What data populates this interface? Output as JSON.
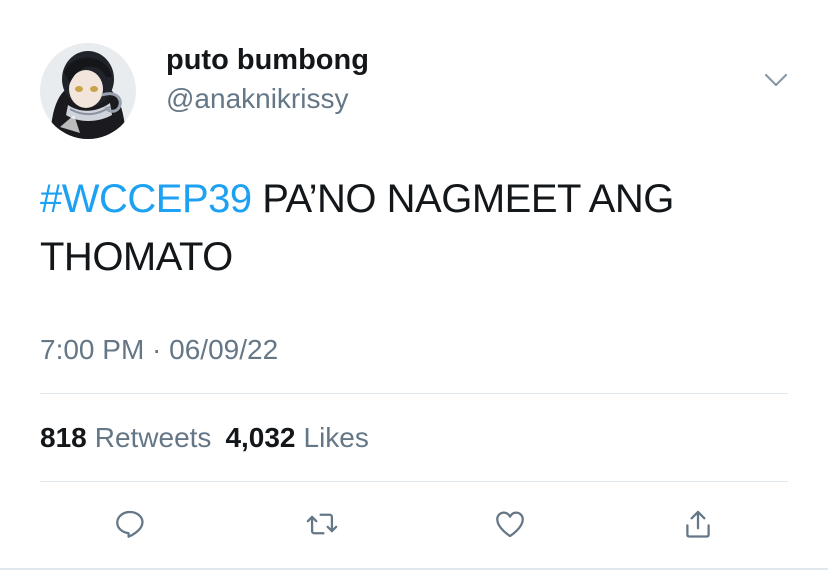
{
  "user": {
    "display_name": "puto bumbong",
    "handle": "@anaknikrissy"
  },
  "tweet": {
    "hashtag": "#WCCEP39",
    "text": " PA’NO NAGMEET ANG THOMATO",
    "timestamp": "7:00 PM · 06/09/22"
  },
  "stats": {
    "retweets_count": "818",
    "retweets_label": "Retweets",
    "likes_count": "4,032",
    "likes_label": "Likes"
  },
  "actions": {
    "reply_icon": "reply-icon",
    "retweet_icon": "retweet-icon",
    "like_icon": "heart-icon",
    "share_icon": "share-icon"
  },
  "colors": {
    "accent": "#1da1f2",
    "secondary_text": "#657786",
    "icon": "#657786"
  }
}
